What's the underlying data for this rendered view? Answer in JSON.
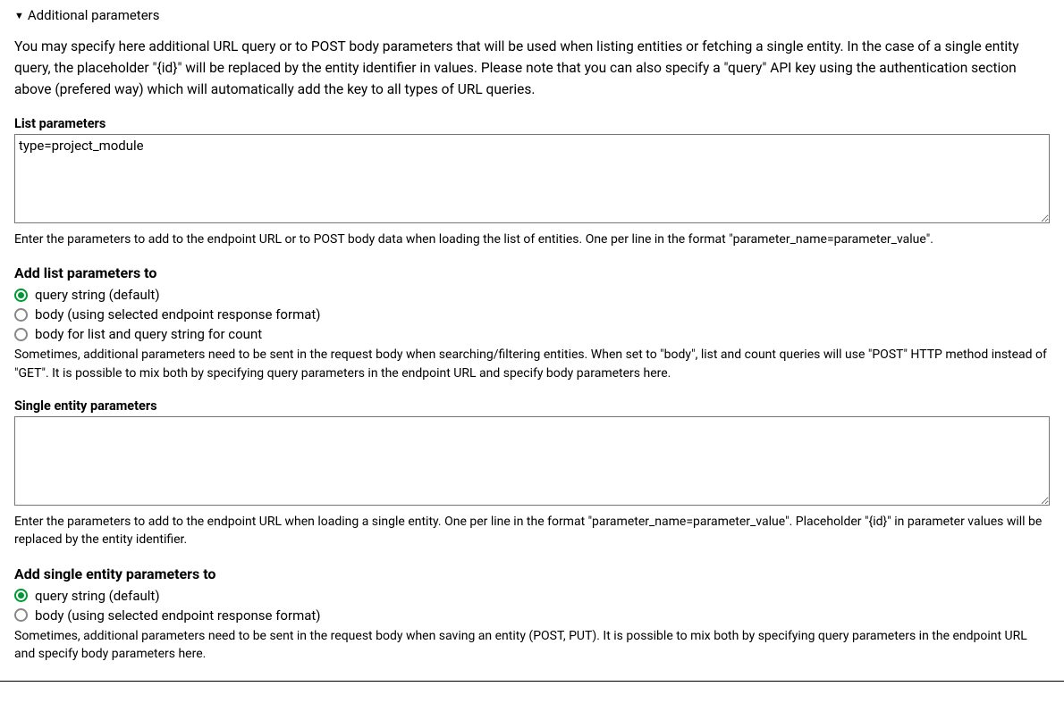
{
  "header": {
    "title": "Additional parameters"
  },
  "intro": "You may specify here additional URL query or to POST body parameters that will be used when listing entities or fetching a single entity. In the case of a single entity query, the placeholder \"{id}\" will be replaced by the entity identifier in values. Please note that you can also specify a \"query\" API key using the authentication section above (prefered way) which will automatically add the key to all types of URL queries.",
  "list_params": {
    "label": "List parameters",
    "value": "type=project_module",
    "help": "Enter the parameters to add to the endpoint URL or to POST body data when loading the list of entities. One per line in the format \"parameter_name=parameter_value\"."
  },
  "list_target": {
    "label": "Add list parameters to",
    "options": [
      "query string (default)",
      "body (using selected endpoint response format)",
      "body for list and query string for count"
    ],
    "selected": 0,
    "help": "Sometimes, additional parameters need to be sent in the request body when searching/filtering entities. When set to \"body\", list and count queries will use \"POST\" HTTP method instead of \"GET\". It is possible to mix both by specifying query parameters in the endpoint URL and specify body parameters here."
  },
  "single_params": {
    "label": "Single entity parameters",
    "value": "",
    "help": "Enter the parameters to add to the endpoint URL when loading a single entity. One per line in the format \"parameter_name=parameter_value\". Placeholder \"{id}\" in param­eter values will be replaced by the entity identifier."
  },
  "single_target": {
    "label": "Add single entity parameters to",
    "options": [
      "query string (default)",
      "body (using selected endpoint response format)"
    ],
    "selected": 0,
    "help": "Sometimes, additional parameters need to be sent in the request body when saving an entity (POST, PUT). It is possible to mix both by specifying query parameters in the endpoint URL and specify body parameters here."
  }
}
